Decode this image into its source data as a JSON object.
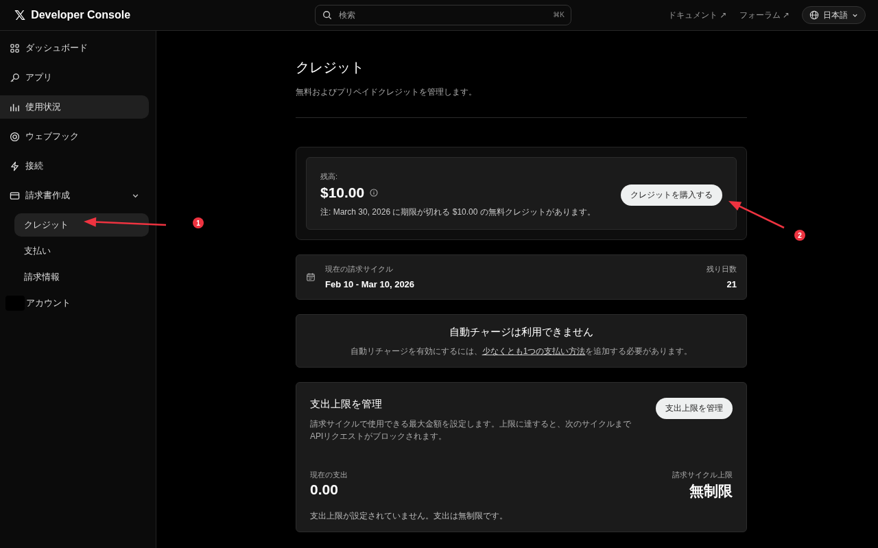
{
  "header": {
    "logo": "𝕏",
    "title": "Developer Console",
    "search": {
      "placeholder": "検索",
      "shortcut": "⌘K"
    },
    "links": [
      {
        "label": "ドキュメント ↗"
      },
      {
        "label": "フォーラム ↗"
      }
    ],
    "language": "日本語"
  },
  "sidebar": {
    "items": [
      {
        "label": "ダッシュボード",
        "selected": false,
        "highlighted": false
      },
      {
        "label": "アプリ",
        "selected": false,
        "highlighted": false
      },
      {
        "label": "使用状況",
        "selected": false,
        "highlighted": true
      },
      {
        "label": "ウェブフック",
        "selected": false,
        "highlighted": false
      },
      {
        "label": "接続",
        "selected": false,
        "highlighted": false
      },
      {
        "label": "請求書作成",
        "selected": false,
        "highlighted": false,
        "expanded": true,
        "children": [
          {
            "label": "クレジット",
            "selected": true
          },
          {
            "label": "支払い",
            "selected": false
          },
          {
            "label": "請求情報",
            "selected": false
          }
        ]
      },
      {
        "label": "アカウント",
        "selected": false,
        "highlighted": false
      }
    ]
  },
  "page": {
    "title": "クレジット",
    "subtitle": "無料およびプリペイドクレジットを管理します。"
  },
  "balance": {
    "label": "残高:",
    "amount": "$10.00",
    "note": "注: March 30, 2026 に期限が切れる $10.00 の無料クレジットがあります。",
    "button": "クレジットを購入する"
  },
  "billing_cycle": {
    "label": "現在の請求サイクル",
    "dates": "Feb 10 - Mar 10, 2026",
    "remaining_label": "残り日数",
    "remaining": "21"
  },
  "auto_charge": {
    "title": "自動チャージは利用できません",
    "text_before": "自動リチャージを有効にするには、",
    "link": "少なくとも1つの支払い方法",
    "text_after": "を追加する必要があります。"
  },
  "spending_limit": {
    "title": "支出上限を管理",
    "description": "請求サイクルで使用できる最大金額を設定します。上限に達すると、次のサイクルまでAPIリクエストがブロックされます。",
    "button": "支出上限を管理",
    "current_label": "現在の支出",
    "current": "0.00",
    "limit_label": "請求サイクル上限",
    "limit": "無制限",
    "footer": "支出上限が設定されていません。支出は無制限です。"
  },
  "annotations": [
    {
      "label": "1"
    },
    {
      "label": "2"
    }
  ]
}
